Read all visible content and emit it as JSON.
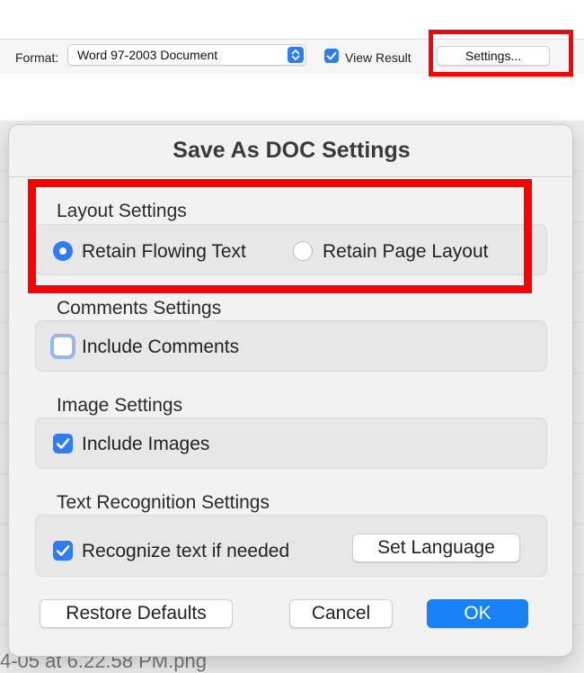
{
  "toolbar": {
    "format_label": "Format:",
    "format_value": "Word 97-2003 Document",
    "view_result_label": "View Result",
    "view_result_checked": true,
    "settings_button": "Settings..."
  },
  "background": {
    "file_name": "4-05 at 6.22.58 PM.png"
  },
  "dialog": {
    "title": "Save As DOC Settings",
    "layout": {
      "label": "Layout Settings",
      "options": [
        "Retain Flowing Text",
        "Retain Page Layout"
      ],
      "selected": "Retain Flowing Text"
    },
    "comments": {
      "label": "Comments Settings",
      "include_label": "Include Comments",
      "checked": false
    },
    "images": {
      "label": "Image Settings",
      "include_label": "Include Images",
      "checked": true
    },
    "text_recognition": {
      "label": "Text Recognition Settings",
      "recognize_label": "Recognize text if needed",
      "checked": true,
      "set_language_button": "Set Language"
    },
    "buttons": {
      "restore_defaults": "Restore Defaults",
      "cancel": "Cancel",
      "ok": "OK"
    }
  },
  "colors": {
    "accent": "#2f7df6",
    "primary_button": "#1a82f7",
    "highlight": "#ff0000"
  }
}
